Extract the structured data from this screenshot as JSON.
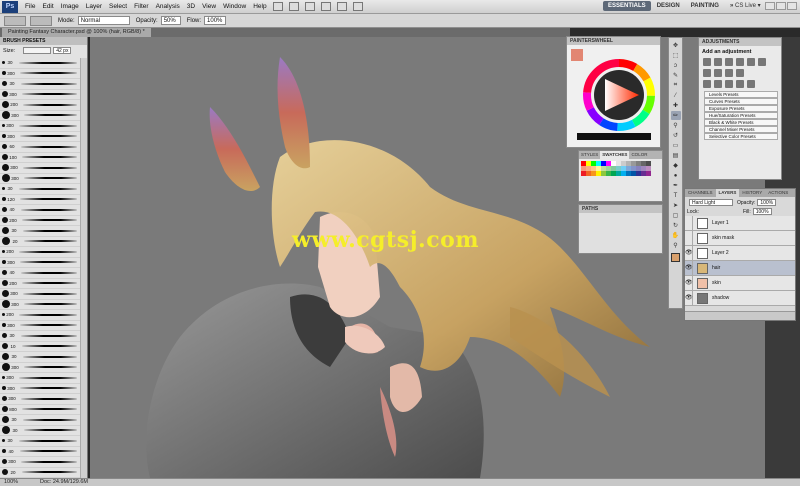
{
  "menubar": {
    "logo": "Ps",
    "items": [
      "File",
      "Edit",
      "Image",
      "Layer",
      "Select",
      "Filter",
      "Analysis",
      "3D",
      "View",
      "Window",
      "Help"
    ],
    "workspaces": [
      "ESSENTIALS",
      "DESIGN",
      "PAINTING",
      "»"
    ],
    "cslive": "CS Live ▾"
  },
  "options": {
    "mode_label": "Mode:",
    "mode_value": "Normal",
    "opacity_label": "Opacity:",
    "opacity_value": "50%",
    "flow_label": "Flow:",
    "flow_value": "100%"
  },
  "document": {
    "tab": "Painting Fantasy Character.psd @ 100% (hair, RGB/8) *",
    "watermark": "www.cgtsj.com",
    "zoom": "100%",
    "doc_size": "Doc: 24.9M/129.6M"
  },
  "brush_panel": {
    "title": "BRUSH PRESETS",
    "size_label": "Size:",
    "size_value": "42 px",
    "brush_numbers": [
      "30",
      "300",
      "30",
      "300",
      "200",
      "300",
      "300",
      "300",
      "60",
      "100",
      "300",
      "300",
      "30",
      "120",
      "40",
      "200",
      "30",
      "20",
      "200",
      "300",
      "40",
      "200",
      "300",
      "300",
      "200",
      "300",
      "30",
      "10",
      "30",
      "300",
      "300",
      "300",
      "300",
      "800",
      "30",
      "30",
      "30",
      "40",
      "300",
      "20"
    ]
  },
  "painter_wheel": {
    "title": "PAINTERSWHEEL",
    "fg_color": "#e28672"
  },
  "swatches": {
    "tabs": [
      "STYLES",
      "SWATCHES",
      "COLOR"
    ],
    "colors": [
      "#ff0000",
      "#ffff00",
      "#00ff00",
      "#00ffff",
      "#0000ff",
      "#ff00ff",
      "#ffffff",
      "#e6e6e6",
      "#cccccc",
      "#b3b3b3",
      "#999999",
      "#808080",
      "#666666",
      "#4d4d4d",
      "#f7977a",
      "#f9ad81",
      "#fdc68a",
      "#fff79a",
      "#c4df9b",
      "#a2d39c",
      "#82ca9d",
      "#7bcdc8",
      "#6ecff6",
      "#7ea7d8",
      "#8493ca",
      "#8882be",
      "#a187be",
      "#bc8dbf",
      "#ed1c24",
      "#f26522",
      "#f7941d",
      "#fff200",
      "#8dc73f",
      "#39b54a",
      "#00a651",
      "#00a99d",
      "#00aeef",
      "#0072bc",
      "#0054a6",
      "#2e3192",
      "#662d91",
      "#92278f"
    ]
  },
  "paths": {
    "title": "PATHS"
  },
  "adjustments": {
    "title": "ADJUSTMENTS",
    "heading": "Add an adjustment",
    "presets": [
      "Levels Presets",
      "Curves Presets",
      "Exposure Presets",
      "Hue/Saturation Presets",
      "Black & White Presets",
      "Channel Mixer Presets",
      "Selective Color Presets"
    ]
  },
  "layers": {
    "tabs": [
      "CHANNELS",
      "LAYERS",
      "HISTORY",
      "ACTIONS"
    ],
    "blend_mode": "Hard Light",
    "opacity_label": "Opacity:",
    "opacity_value": "100%",
    "lock_label": "Lock:",
    "fill_label": "Fill:",
    "fill_value": "100%",
    "rows": [
      {
        "name": "Layer 1"
      },
      {
        "name": "skin mask"
      },
      {
        "name": "Layer 2"
      },
      {
        "name": "hair"
      },
      {
        "name": "skin"
      },
      {
        "name": "shadow"
      }
    ]
  }
}
